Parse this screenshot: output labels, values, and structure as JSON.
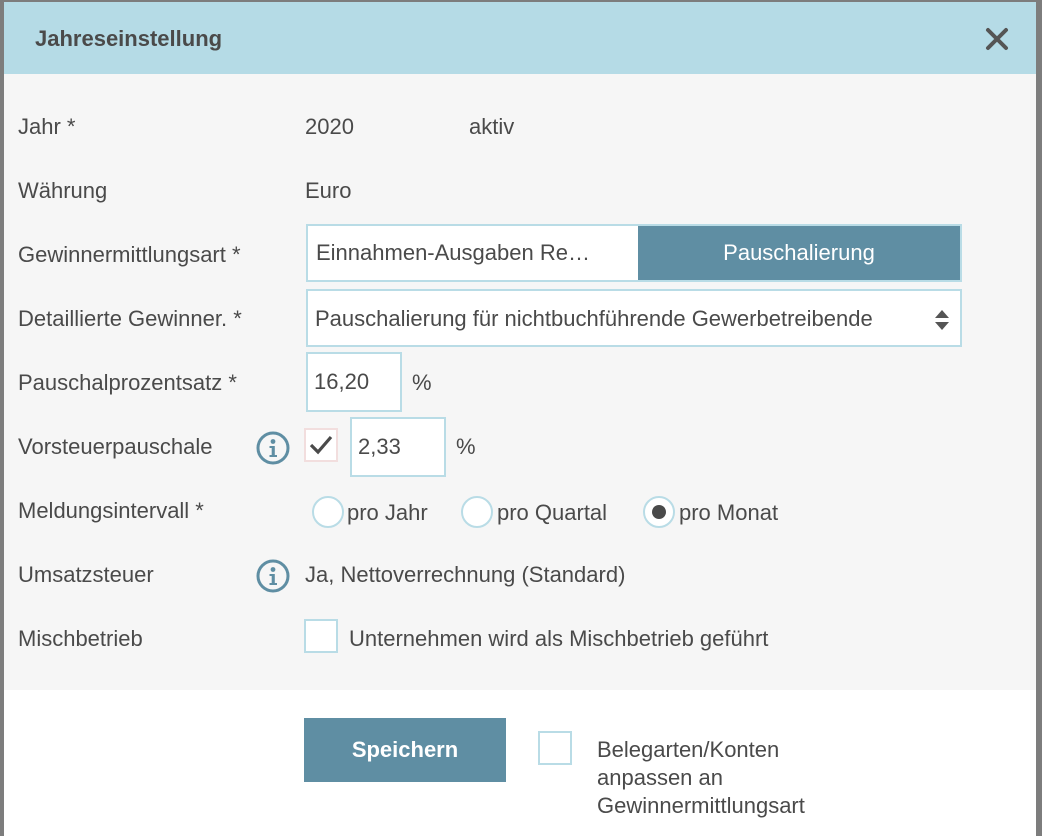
{
  "dialog": {
    "title": "Jahreseinstellung",
    "close_icon": "close-icon"
  },
  "year": {
    "label": "Jahr  *",
    "value": "2020",
    "status": "aktiv"
  },
  "currency": {
    "label": "Währung",
    "value": "Euro"
  },
  "profit_method": {
    "label": "Gewinnermittlungsart  *",
    "options": [
      "Einnahmen-Ausgaben Re…",
      "Pauschalierung"
    ],
    "selected": "Pauschalierung"
  },
  "detailed_profit": {
    "label": "Detaillierte Gewinner.  *",
    "value": "Pauschalierung für nichtbuchführende Gewerbetreibende"
  },
  "flat_rate": {
    "label": "Pauschalprozentsatz  *",
    "value": "16,20",
    "unit": "%"
  },
  "input_tax": {
    "label": "Vorsteuerpauschale",
    "checked": true,
    "value": "2,33",
    "unit": "%",
    "info_icon": "info-icon"
  },
  "reporting_interval": {
    "label": "Meldungsintervall  *",
    "options": [
      "pro Jahr",
      "pro Quartal",
      "pro Monat"
    ],
    "selected": "pro Monat"
  },
  "vat": {
    "label": "Umsatzsteuer",
    "value": "Ja, Nettoverrechnung (Standard)",
    "info_icon": "info-icon"
  },
  "mixed_business": {
    "label": "Mischbetrieb",
    "checkbox_label": "Unternehmen wird als Mischbetrieb geführt",
    "checked": false
  },
  "footer": {
    "save_label": "Speichern",
    "adjust_label": "Belegarten/Konten anpassen an Gewinnermittlungsart",
    "adjust_checked": false
  },
  "colors": {
    "header_bg": "#b5dbe6",
    "accent": "#5f8ea3",
    "border": "#b9dce6",
    "text": "#4a4a4a"
  }
}
